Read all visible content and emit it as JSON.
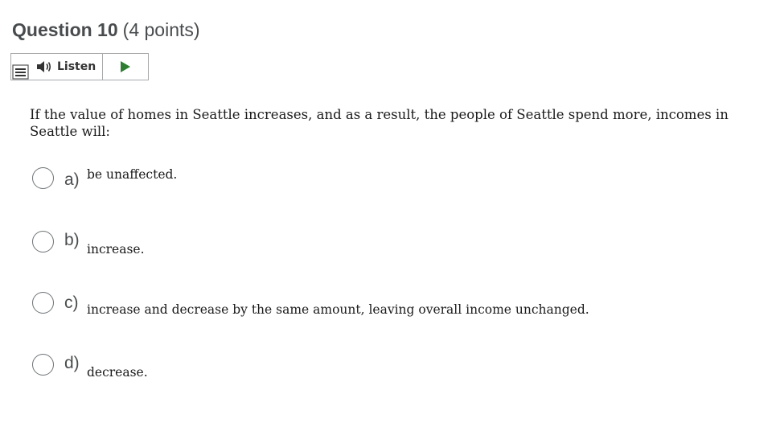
{
  "question": {
    "number_label": "Question 10",
    "points_label": "(4 points)",
    "text": "If the value of homes in Seattle increases, and as a result, the people of Seattle spend more, incomes in Seattle will:"
  },
  "listen_widget": {
    "label": "Listen",
    "menu_icon": "menu-icon",
    "speaker_icon": "speaker-icon",
    "play_icon": "play-icon",
    "play_color": "#2e7d32"
  },
  "options": [
    {
      "letter": "a)",
      "text": "be unaffected.",
      "selected": false
    },
    {
      "letter": "b)",
      "text": "increase.",
      "selected": false
    },
    {
      "letter": "c)",
      "text": "increase and decrease by the same amount, leaving overall income unchanged.",
      "selected": false
    },
    {
      "letter": "d)",
      "text": "decrease.",
      "selected": false
    }
  ]
}
